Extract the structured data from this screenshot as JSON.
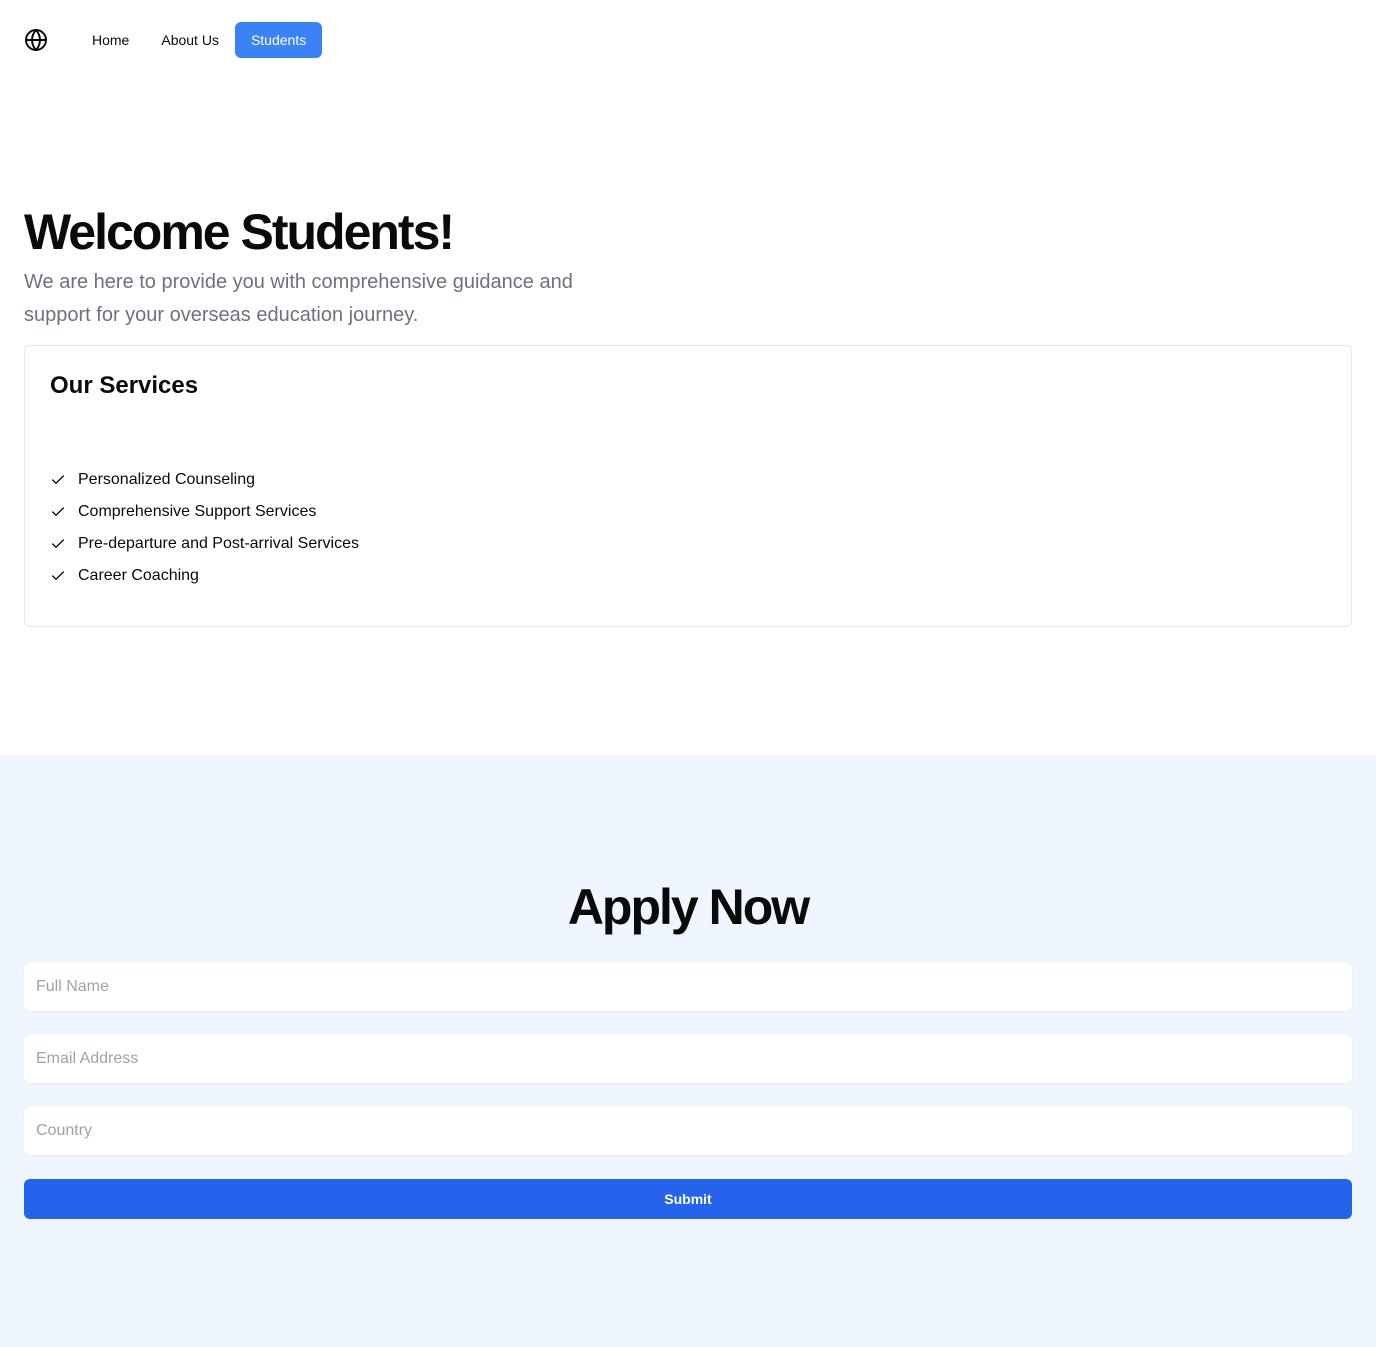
{
  "nav": {
    "logo_icon": "globe-icon",
    "links": [
      {
        "label": "Home",
        "active": false
      },
      {
        "label": "About Us",
        "active": false
      },
      {
        "label": "Students",
        "active": true
      }
    ],
    "accent_color": "#3b82f6"
  },
  "hero": {
    "title": "Welcome Students!",
    "subtitle": "We are here to provide you with comprehensive guidance and support for your overseas education journey."
  },
  "services": {
    "title": "Our Services",
    "item_icon": "check-icon",
    "items": [
      "Personalized Counseling",
      "Comprehensive Support Services",
      "Pre-departure and Post-arrival Services",
      "Career Coaching"
    ]
  },
  "apply": {
    "title": "Apply Now",
    "background_color": "#eff6ff",
    "fields": {
      "full_name": {
        "placeholder": "Full Name",
        "value": ""
      },
      "email": {
        "placeholder": "Email Address",
        "value": ""
      },
      "country": {
        "placeholder": "Country",
        "value": ""
      }
    },
    "submit_label": "Submit",
    "submit_color": "#2563eb"
  }
}
